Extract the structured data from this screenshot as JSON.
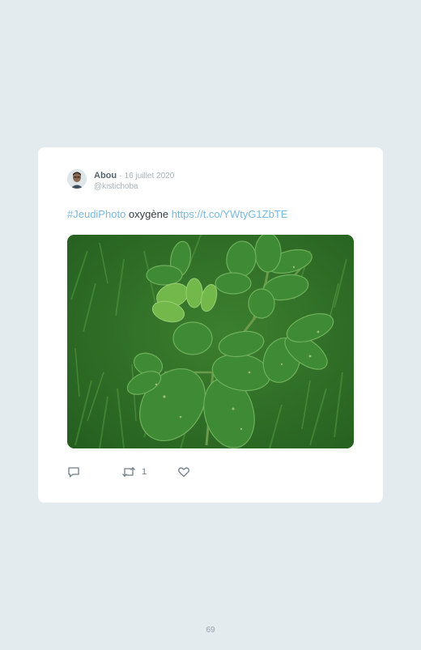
{
  "tweet": {
    "author": {
      "name": "Abou",
      "separator": "·",
      "date": "16 juillet 2020",
      "handle": "@kistichoba"
    },
    "text": {
      "hashtag": "#JeudiPhoto",
      "word": "oxygène",
      "url": "https://t.co/YWtyG1ZbTE"
    },
    "media": {
      "alt": "photo of green leaves over grass"
    },
    "actions": {
      "reply_icon": "reply-icon",
      "retweet_icon": "retweet-icon",
      "retweet_count": "1",
      "like_icon": "heart-icon"
    }
  },
  "page": {
    "number": "69"
  },
  "colors": {
    "background": "#e4ebee",
    "card": "#ffffff",
    "link": "#77b9df",
    "muted": "#a6b2b9"
  }
}
